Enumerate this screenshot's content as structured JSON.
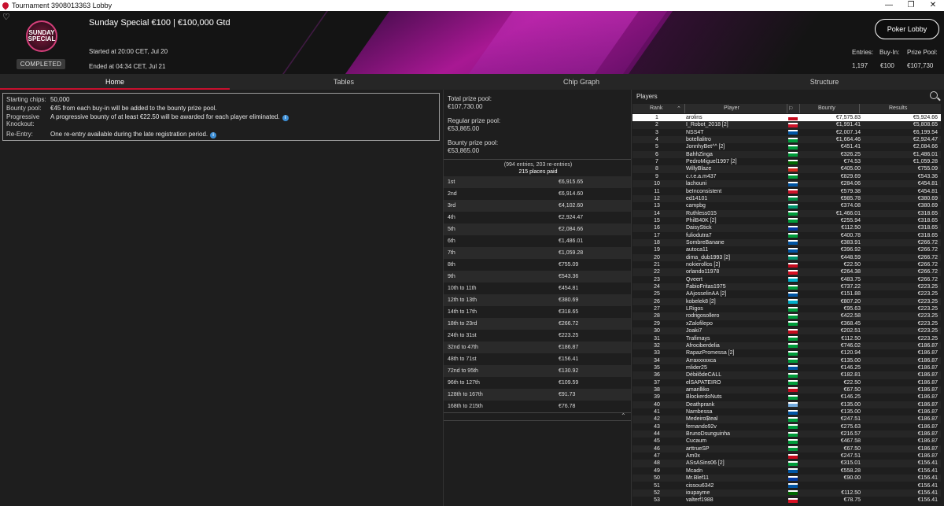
{
  "window": {
    "title": "Tournament 3908013363 Lobby",
    "minimize": "—",
    "maximize": "❐",
    "close": "✕"
  },
  "header": {
    "logo_line1": "SUNDAY",
    "logo_line2": "SPECIAL",
    "status_badge": "COMPLETED",
    "title": "Sunday Special €100 | €100,000 Gtd",
    "started": "Started at 20:00 CET, Jul 20",
    "ended": "Ended at 04:34 CET, Jul 21",
    "poker_lobby_label": "Poker Lobby",
    "entries_label": "Entries:",
    "entries_value": "1,197",
    "buyin_label": "Buy-In:",
    "buyin_value": "€100",
    "prizepool_label": "Prize Pool:",
    "prizepool_value": "€107,730"
  },
  "tabs": [
    "Home",
    "Tables",
    "Chip Graph",
    "Structure"
  ],
  "info": {
    "starting_chips_label": "Starting chips:",
    "starting_chips_value": "50,000",
    "bounty_pool_label": "Bounty pool:",
    "bounty_pool_value": "€45 from each buy-in will be added to the bounty prize pool.",
    "pko_label_1": "Progressive",
    "pko_label_2": "Knockout:",
    "pko_value": "A progressive bounty of at least €22.50 will be awarded for each player eliminated.",
    "reentry_label": "Re-Entry:",
    "reentry_value": "One re-entry available during the late registration period."
  },
  "pools": {
    "total_label": "Total prize pool:",
    "total_value": "€107,730.00",
    "regular_label": "Regular prize pool:",
    "regular_value": "€53,865.00",
    "bounty_label": "Bounty prize pool:",
    "bounty_value": "€53,865.00",
    "entries_note": "(994 entries, 203 re-entries)",
    "places_paid": "215 places paid"
  },
  "payouts": [
    {
      "place": "1st",
      "amount": "€6,915.65"
    },
    {
      "place": "2nd",
      "amount": "€6,914.60"
    },
    {
      "place": "3rd",
      "amount": "€4,102.60"
    },
    {
      "place": "4th",
      "amount": "€2,924.47"
    },
    {
      "place": "5th",
      "amount": "€2,084.66"
    },
    {
      "place": "6th",
      "amount": "€1,486.01"
    },
    {
      "place": "7th",
      "amount": "€1,059.28"
    },
    {
      "place": "8th",
      "amount": "€755.09"
    },
    {
      "place": "9th",
      "amount": "€543.36"
    },
    {
      "place": "10th to 11th",
      "amount": "€454.81"
    },
    {
      "place": "12th to 13th",
      "amount": "€380.69"
    },
    {
      "place": "14th to 17th",
      "amount": "€318.65"
    },
    {
      "place": "18th to 23rd",
      "amount": "€266.72"
    },
    {
      "place": "24th to 31st",
      "amount": "€223.25"
    },
    {
      "place": "32nd to 47th",
      "amount": "€186.87"
    },
    {
      "place": "48th to 71st",
      "amount": "€156.41"
    },
    {
      "place": "72nd to 95th",
      "amount": "€130.92"
    },
    {
      "place": "96th to 127th",
      "amount": "€109.59"
    },
    {
      "place": "128th to 167th",
      "amount": "€91.73"
    },
    {
      "place": "168th to 215th",
      "amount": "€76.78"
    }
  ],
  "players_panel": {
    "title": "Players",
    "col_rank": "Rank",
    "col_player": "Player",
    "col_bounty": "Bounty",
    "col_results": "Results",
    "flag_colors": {
      "es": "#c60b1e",
      "gb": "#cf142b",
      "fr": "#0055a4",
      "br": "#009c3b",
      "ar": "#74acdf",
      "ca": "#d52b1e",
      "it": "#009246",
      "nl": "#ae1c28",
      "bg": "#00966e",
      "pt": "#006600",
      "ru": "#0039a6",
      "kz": "#00afca",
      "pe": "#d91023"
    },
    "rows": [
      {
        "rank": "1",
        "name": "arolins",
        "flag": "es",
        "bounty": "€7,575.83",
        "result": "€5,924.66"
      },
      {
        "rank": "2",
        "name": "I_Robot_2018 [2]",
        "flag": "gb",
        "bounty": "€1,991.41",
        "result": "€5,808.65"
      },
      {
        "rank": "3",
        "name": "NSS4T",
        "flag": "fr",
        "bounty": "€2,007.14",
        "result": "€6,199.54"
      },
      {
        "rank": "4",
        "name": "botellalitro",
        "flag": "br",
        "bounty": "€1,664.46",
        "result": "€2,924.47"
      },
      {
        "rank": "5",
        "name": "JonnhyBet^^ [2]",
        "flag": "br",
        "bounty": "€451.41",
        "result": "€2,084.66"
      },
      {
        "rank": "6",
        "name": "BahhZinga",
        "flag": "br",
        "bounty": "€326.25",
        "result": "€1,486.01"
      },
      {
        "rank": "7",
        "name": "PedroMiguel1997 [2]",
        "flag": "pt",
        "bounty": "€74.53",
        "result": "€1,059.28"
      },
      {
        "rank": "8",
        "name": "WillyBlaze",
        "flag": "ca",
        "bounty": "€405.00",
        "result": "€755.09"
      },
      {
        "rank": "9",
        "name": "c.r.e.a.m437",
        "flag": "br",
        "bounty": "€829.69",
        "result": "€543.36"
      },
      {
        "rank": "10",
        "name": "lachouni",
        "flag": "fr",
        "bounty": "€284.06",
        "result": "€454.81"
      },
      {
        "rank": "11",
        "name": "beInconsistent",
        "flag": "gb",
        "bounty": "€579.38",
        "result": "€454.81"
      },
      {
        "rank": "12",
        "name": "ed14101",
        "flag": "it",
        "bounty": "€985.78",
        "result": "€380.69"
      },
      {
        "rank": "13",
        "name": "campbg",
        "flag": "bg",
        "bounty": "€374.08",
        "result": "€380.69"
      },
      {
        "rank": "14",
        "name": "Ruthless015",
        "flag": "br",
        "bounty": "€1,466.01",
        "result": "€318.65"
      },
      {
        "rank": "15",
        "name": "PhilB40K [2]",
        "flag": "br",
        "bounty": "€255.94",
        "result": "€318.65"
      },
      {
        "rank": "16",
        "name": "DaisyStick",
        "flag": "ru",
        "bounty": "€112.50",
        "result": "€318.65"
      },
      {
        "rank": "17",
        "name": "fuliodutra7",
        "flag": "br",
        "bounty": "€400.78",
        "result": "€318.65"
      },
      {
        "rank": "18",
        "name": "SombreBanane",
        "flag": "fr",
        "bounty": "€383.91",
        "result": "€266.72"
      },
      {
        "rank": "19",
        "name": "autoca11",
        "flag": "fr",
        "bounty": "€396.92",
        "result": "€266.72"
      },
      {
        "rank": "20",
        "name": "dima_dub1993 [2]",
        "flag": "bg",
        "bounty": "€448.59",
        "result": "€266.72"
      },
      {
        "rank": "21",
        "name": "nokierollos [2]",
        "flag": "es",
        "bounty": "€22.50",
        "result": "€266.72"
      },
      {
        "rank": "22",
        "name": "orlando11978",
        "flag": "pe",
        "bounty": "€264.38",
        "result": "€266.72"
      },
      {
        "rank": "23",
        "name": "Qveert",
        "flag": "kz",
        "bounty": "€483.75",
        "result": "€266.72"
      },
      {
        "rank": "24",
        "name": "FabioFritas1975",
        "flag": "br",
        "bounty": "€737.22",
        "result": "€223.25"
      },
      {
        "rank": "25",
        "name": "AAjosselinAA [2]",
        "flag": "fr",
        "bounty": "€151.88",
        "result": "€223.25"
      },
      {
        "rank": "26",
        "name": "kobelek8 [2]",
        "flag": "kz",
        "bounty": "€807.20",
        "result": "€223.25"
      },
      {
        "rank": "27",
        "name": "LRigos",
        "flag": "br",
        "bounty": "€95.63",
        "result": "€223.25"
      },
      {
        "rank": "28",
        "name": "rodrigosollero",
        "flag": "br",
        "bounty": "€422.58",
        "result": "€223.25"
      },
      {
        "rank": "29",
        "name": "xZalofilepo",
        "flag": "br",
        "bounty": "€368.45",
        "result": "€223.25"
      },
      {
        "rank": "30",
        "name": "Joaki7",
        "flag": "es",
        "bounty": "€202.51",
        "result": "€223.25"
      },
      {
        "rank": "31",
        "name": "Trafimays",
        "flag": "br",
        "bounty": "€112.50",
        "result": "€223.25"
      },
      {
        "rank": "32",
        "name": "Afrociberdelia",
        "flag": "br",
        "bounty": "€746.02",
        "result": "€186.87"
      },
      {
        "rank": "33",
        "name": "RapazPromessa [2]",
        "flag": "br",
        "bounty": "€120.94",
        "result": "€186.87"
      },
      {
        "rank": "34",
        "name": "Arraxxxxxca",
        "flag": "br",
        "bounty": "€135.00",
        "result": "€186.87"
      },
      {
        "rank": "35",
        "name": "mlider25",
        "flag": "fr",
        "bounty": "€146.25",
        "result": "€186.87"
      },
      {
        "rank": "36",
        "name": "DébilôdeCALL",
        "flag": "br",
        "bounty": "€182.81",
        "result": "€186.87"
      },
      {
        "rank": "37",
        "name": "elSAPATEIRO",
        "flag": "br",
        "bounty": "€22.50",
        "result": "€186.87"
      },
      {
        "rank": "38",
        "name": "amarilliko",
        "flag": "es",
        "bounty": "€67.50",
        "result": "€186.87"
      },
      {
        "rank": "39",
        "name": "BlockerdoNuts",
        "flag": "br",
        "bounty": "€146.25",
        "result": "€186.87"
      },
      {
        "rank": "40",
        "name": "Deathprank",
        "flag": "ar",
        "bounty": "€135.00",
        "result": "€186.87"
      },
      {
        "rank": "41",
        "name": "Nambessa",
        "flag": "fr",
        "bounty": "€135.00",
        "result": "€186.87"
      },
      {
        "rank": "42",
        "name": "Medeiro$teal",
        "flag": "br",
        "bounty": "€247.51",
        "result": "€186.87"
      },
      {
        "rank": "43",
        "name": "fernando92v",
        "flag": "br",
        "bounty": "€275.63",
        "result": "€186.87"
      },
      {
        "rank": "44",
        "name": "BrunoDsunguinha",
        "flag": "br",
        "bounty": "€216.57",
        "result": "€186.87"
      },
      {
        "rank": "45",
        "name": "Cucaum",
        "flag": "br",
        "bounty": "€467.58",
        "result": "€186.87"
      },
      {
        "rank": "46",
        "name": "arttrueSP",
        "flag": "br",
        "bounty": "€67.50",
        "result": "€186.87"
      },
      {
        "rank": "47",
        "name": "Am0x",
        "flag": "es",
        "bounty": "€247.51",
        "result": "€186.87"
      },
      {
        "rank": "48",
        "name": "ASsASins06 [2]",
        "flag": "br",
        "bounty": "€315.01",
        "result": "€156.41"
      },
      {
        "rank": "49",
        "name": "Mcadn",
        "flag": "fr",
        "bounty": "€558.28",
        "result": "€156.41"
      },
      {
        "rank": "50",
        "name": "Mr.Blef11",
        "flag": "ru",
        "bounty": "€90.00",
        "result": "€156.41"
      },
      {
        "rank": "51",
        "name": "cissou6342",
        "flag": "fr",
        "bounty": "",
        "result": "€156.41"
      },
      {
        "rank": "52",
        "name": "ioupayme",
        "flag": "pt",
        "bounty": "€112.50",
        "result": "€156.41"
      },
      {
        "rank": "53",
        "name": "valterf1988",
        "flag": "pe",
        "bounty": "€78.75",
        "result": "€156.41"
      }
    ]
  }
}
